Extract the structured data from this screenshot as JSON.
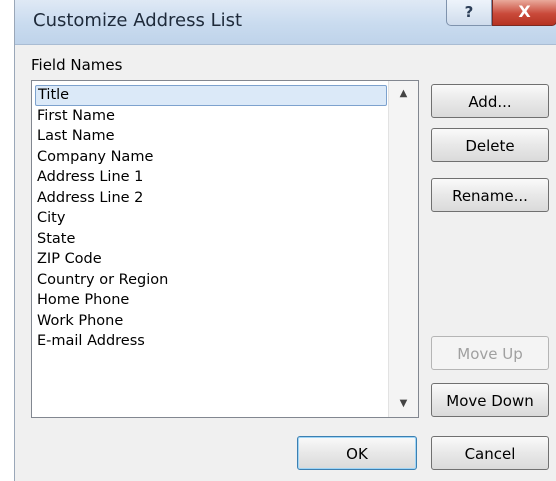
{
  "window": {
    "title": "Customize Address List",
    "help_glyph": "?",
    "close_glyph": "X"
  },
  "field_names": {
    "label": "Field Names",
    "items": [
      "Title",
      "First Name",
      "Last Name",
      "Company Name",
      "Address Line 1",
      "Address Line 2",
      "City",
      "State",
      "ZIP Code",
      "Country or Region",
      "Home Phone",
      "Work Phone",
      "E-mail Address"
    ],
    "selected_index": 0
  },
  "buttons": {
    "add": "Add...",
    "delete": "Delete",
    "rename": "Rename...",
    "move_up": "Move Up",
    "move_down": "Move Down",
    "ok": "OK",
    "cancel": "Cancel"
  },
  "icons": {
    "scroll_up": "▲",
    "scroll_down": "▼"
  }
}
